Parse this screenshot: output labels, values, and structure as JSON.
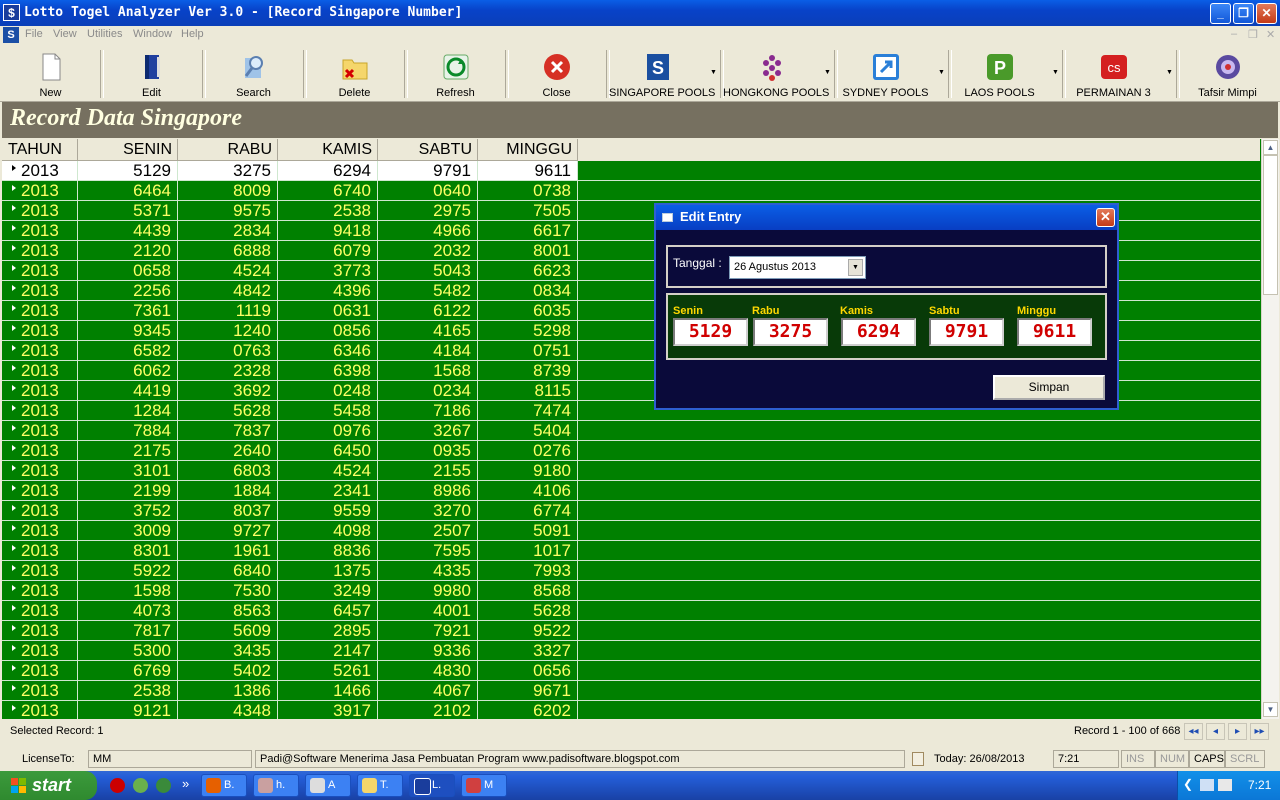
{
  "window": {
    "title": "Lotto Togel Analyzer Ver 3.0 - [Record Singapore Number]",
    "min": "_",
    "restore": "❐",
    "close": "✕"
  },
  "menu": {
    "items": [
      "File",
      "View",
      "Utilities",
      "Window",
      "Help"
    ],
    "mdi_min": "–",
    "mdi_restore": "❐",
    "mdi_close": "✕"
  },
  "toolbar": {
    "new": "New",
    "edit": "Edit",
    "search": "Search",
    "delete": "Delete",
    "refresh": "Refresh",
    "close": "Close",
    "singapore": "SINGAPORE POOLS",
    "hongkong": "HONGKONG POOLS",
    "sydney": "SYDNEY POOLS",
    "laos": "LAOS POOLS",
    "permainan": "PERMAINAN 3",
    "tafsir": "Tafsir Mimpi",
    "icon_p": "P",
    "icon_s": "S",
    "icon_perm": "cs",
    "dropdown": "▼"
  },
  "header": {
    "title": "Record Data Singapore"
  },
  "grid": {
    "columns": [
      "TAHUN",
      "SENIN",
      "RABU",
      "KAMIS",
      "SABTU",
      "MINGGU"
    ],
    "rows": [
      [
        "2013",
        "5129",
        "3275",
        "6294",
        "9791",
        "9611"
      ],
      [
        "2013",
        "6464",
        "8009",
        "6740",
        "0640",
        "0738"
      ],
      [
        "2013",
        "5371",
        "9575",
        "2538",
        "2975",
        "7505"
      ],
      [
        "2013",
        "4439",
        "2834",
        "9418",
        "4966",
        "6617"
      ],
      [
        "2013",
        "2120",
        "6888",
        "6079",
        "2032",
        "8001"
      ],
      [
        "2013",
        "0658",
        "4524",
        "3773",
        "5043",
        "6623"
      ],
      [
        "2013",
        "2256",
        "4842",
        "4396",
        "5482",
        "0834"
      ],
      [
        "2013",
        "7361",
        "1119",
        "0631",
        "6122",
        "6035"
      ],
      [
        "2013",
        "9345",
        "1240",
        "0856",
        "4165",
        "5298"
      ],
      [
        "2013",
        "6582",
        "0763",
        "6346",
        "4184",
        "0751"
      ],
      [
        "2013",
        "6062",
        "2328",
        "6398",
        "1568",
        "8739"
      ],
      [
        "2013",
        "4419",
        "3692",
        "0248",
        "0234",
        "8115"
      ],
      [
        "2013",
        "1284",
        "5628",
        "5458",
        "7186",
        "7474"
      ],
      [
        "2013",
        "7884",
        "7837",
        "0976",
        "3267",
        "5404"
      ],
      [
        "2013",
        "2175",
        "2640",
        "6450",
        "0935",
        "0276"
      ],
      [
        "2013",
        "3101",
        "6803",
        "4524",
        "2155",
        "9180"
      ],
      [
        "2013",
        "2199",
        "1884",
        "2341",
        "8986",
        "4106"
      ],
      [
        "2013",
        "3752",
        "8037",
        "9559",
        "3270",
        "6774"
      ],
      [
        "2013",
        "3009",
        "9727",
        "4098",
        "2507",
        "5091"
      ],
      [
        "2013",
        "8301",
        "1961",
        "8836",
        "7595",
        "1017"
      ],
      [
        "2013",
        "5922",
        "6840",
        "1375",
        "4335",
        "7993"
      ],
      [
        "2013",
        "1598",
        "7530",
        "3249",
        "9980",
        "8568"
      ],
      [
        "2013",
        "4073",
        "8563",
        "6457",
        "4001",
        "5628"
      ],
      [
        "2013",
        "7817",
        "5609",
        "2895",
        "7921",
        "9522"
      ],
      [
        "2013",
        "5300",
        "3435",
        "2147",
        "9336",
        "3327"
      ],
      [
        "2013",
        "6769",
        "5402",
        "5261",
        "4830",
        "0656"
      ],
      [
        "2013",
        "2538",
        "1386",
        "1466",
        "4067",
        "9671"
      ],
      [
        "2013",
        "9121",
        "4348",
        "3917",
        "2102",
        "6202"
      ]
    ],
    "selected_index": 0,
    "selected_label": "Selected Record: 1",
    "record_info": "Record 1 - 100 of 668",
    "nav": [
      "◂◂",
      "◂",
      "▸",
      "▸▸"
    ],
    "scroll_up": "▲",
    "scroll_down": "▼"
  },
  "dialog": {
    "title": "Edit Entry",
    "close": "✕",
    "date_label": "Tanggal :",
    "date_value": "26  Agustus  2013",
    "date_arrow": "▼",
    "fields": [
      {
        "label": "Senin",
        "value": "5129"
      },
      {
        "label": "Rabu",
        "value": "3275"
      },
      {
        "label": "Kamis",
        "value": "6294"
      },
      {
        "label": "Sabtu",
        "value": "9791"
      },
      {
        "label": "Minggu",
        "value": "9611"
      }
    ],
    "save_button": "Simpan"
  },
  "status": {
    "license_label": "LicenseTo:",
    "license_value": "MM",
    "message": "Padi@Software Menerima Jasa Pembuatan Program   www.padisoftware.blogspot.com",
    "today": "Today: 26/08/2013",
    "time": "7:21",
    "ins": "INS",
    "num": "NUM",
    "caps": "CAPS",
    "scrl": "SCRL"
  },
  "taskbar": {
    "start": "start",
    "tasks": [
      "B.",
      "h.",
      "A",
      "T.",
      "L.",
      "M"
    ],
    "quick_more": "»",
    "clock": "7:21",
    "tray_arrow": "❮"
  },
  "colors": {
    "grid_bg": "#008000",
    "grid_text": "#ffff66",
    "dialog_bg": "#0a0a3a",
    "field_text": "#d00000",
    "strip": "#767060"
  }
}
